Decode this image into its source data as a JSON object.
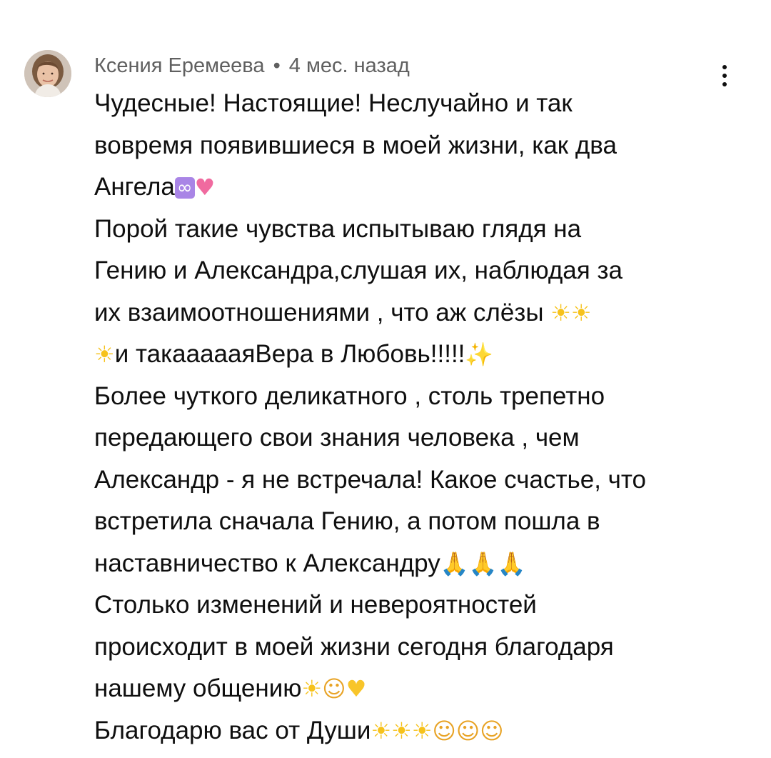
{
  "comment": {
    "author": "Ксения Еремеева",
    "separator": "•",
    "time": "4 мес. назад",
    "menu_icon": "more-vert-icon",
    "avatar_icon": "avatar-photo",
    "lines": [
      [
        {
          "t": "text",
          "v": "Чудесные! Настоящие! Неслучайно и так"
        }
      ],
      [
        {
          "t": "text",
          "v": "вовремя появившиеся в моей жизни, как два"
        }
      ],
      [
        {
          "t": "text",
          "v": "Ангела"
        },
        {
          "t": "emoji",
          "v": "∞",
          "name": "infinity-emoji",
          "cls": "infinity"
        },
        {
          "t": "emoji",
          "v": "♥",
          "name": "growing-heart-emoji",
          "cls": "heart-pink"
        }
      ],
      [
        {
          "t": "text",
          "v": "Порой такие чувства испытываю глядя на"
        }
      ],
      [
        {
          "t": "text",
          "v": "Гению и Александра,слушая их, наблюдая за"
        }
      ],
      [
        {
          "t": "text",
          "v": "их взаимоотношениями , что аж слёзы "
        },
        {
          "t": "emoji",
          "v": "☀",
          "name": "sun-emoji",
          "cls": "sun"
        },
        {
          "t": "emoji",
          "v": "☀",
          "name": "sun-emoji",
          "cls": "sun"
        }
      ],
      [
        {
          "t": "emoji",
          "v": "☀",
          "name": "sun-emoji",
          "cls": "sun"
        },
        {
          "t": "text",
          "v": "и такаааааяВера в Любовь!!!!!"
        },
        {
          "t": "emoji",
          "v": "✨",
          "name": "sparkles-emoji",
          "cls": "sparkles"
        }
      ],
      [
        {
          "t": "text",
          "v": " Более чуткого деликатного , столь трепетно"
        }
      ],
      [
        {
          "t": "text",
          "v": "передающего свои знания человека , чем"
        }
      ],
      [
        {
          "t": "text",
          "v": "Александр - я не встречала! Какое счастье, что"
        }
      ],
      [
        {
          "t": "text",
          "v": "встретила сначала Гению, а потом пошла в"
        }
      ],
      [
        {
          "t": "text",
          "v": "наставничество к Александру"
        },
        {
          "t": "emoji",
          "v": "🙏",
          "name": "folded-hands-emoji",
          "cls": "pray"
        },
        {
          "t": "emoji",
          "v": "🙏",
          "name": "folded-hands-emoji",
          "cls": "pray"
        },
        {
          "t": "emoji",
          "v": "🙏",
          "name": "folded-hands-emoji",
          "cls": "pray"
        }
      ],
      [
        {
          "t": "text",
          "v": "Столько изменений и невероятностей"
        }
      ],
      [
        {
          "t": "text",
          "v": "происходит в моей жизни сегодня благодаря"
        }
      ],
      [
        {
          "t": "text",
          "v": "нашему общению"
        },
        {
          "t": "emoji",
          "v": "☀",
          "name": "sun-emoji",
          "cls": "sun"
        },
        {
          "t": "emoji",
          "v": "☺",
          "name": "smiling-face-emoji",
          "cls": "smile"
        },
        {
          "t": "emoji",
          "v": "♥",
          "name": "yellow-heart-emoji",
          "cls": "heart-yellow"
        }
      ],
      [
        {
          "t": "text",
          "v": "Благодарю вас от Души"
        },
        {
          "t": "emoji",
          "v": "☀",
          "name": "sun-emoji",
          "cls": "sun"
        },
        {
          "t": "emoji",
          "v": "☀",
          "name": "sun-emoji",
          "cls": "sun"
        },
        {
          "t": "emoji",
          "v": "☀",
          "name": "sun-emoji",
          "cls": "sun"
        },
        {
          "t": "emoji",
          "v": "☺",
          "name": "smiling-face-emoji",
          "cls": "smile"
        },
        {
          "t": "emoji",
          "v": "☺",
          "name": "smiling-face-emoji",
          "cls": "smile"
        },
        {
          "t": "emoji",
          "v": "☺",
          "name": "smiling-face-emoji",
          "cls": "smile"
        }
      ]
    ]
  },
  "colors": {
    "text": "#0f0f0f",
    "meta": "#606060",
    "background": "#ffffff"
  }
}
